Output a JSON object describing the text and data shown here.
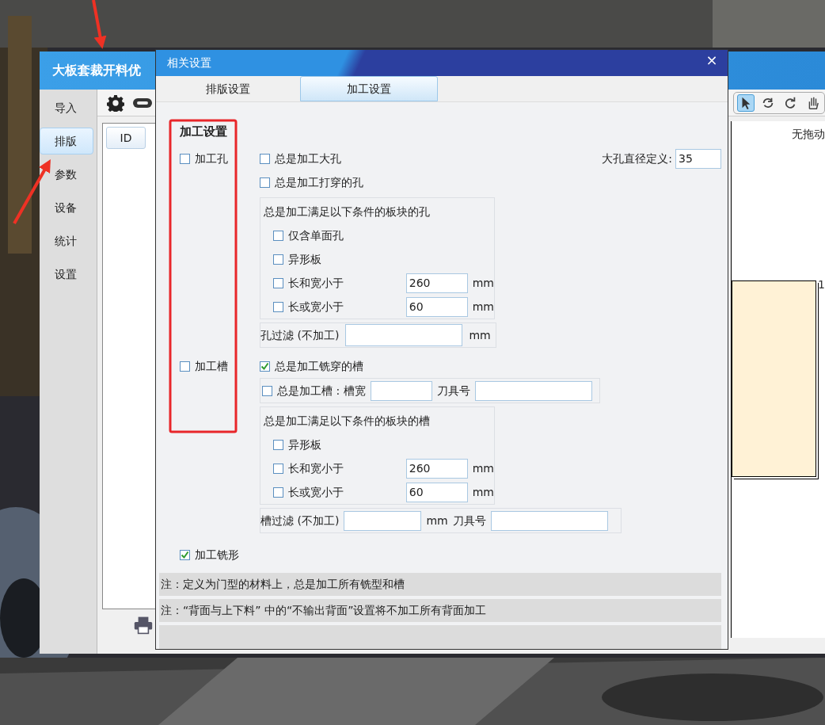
{
  "main_window": {
    "title": "大板套裁开料优",
    "sidebar": [
      {
        "label": "导入",
        "selected": false
      },
      {
        "label": "排版",
        "selected": true
      },
      {
        "label": "参数",
        "selected": false
      },
      {
        "label": "设备",
        "selected": false
      },
      {
        "label": "统计",
        "selected": false
      },
      {
        "label": "设置",
        "selected": false
      }
    ],
    "tools": [
      {
        "kind": "pointer",
        "selected": true
      },
      {
        "kind": "rotate-left",
        "selected": false
      },
      {
        "kind": "rotate-right",
        "selected": false
      },
      {
        "kind": "hand",
        "selected": false
      }
    ],
    "table": {
      "columns": [
        "ID"
      ]
    },
    "canvas": {
      "status": "无拖动",
      "panel_label": "1"
    }
  },
  "dialog": {
    "title": "相关设置",
    "close": "×",
    "tabs": [
      {
        "label": "排版设置",
        "selected": false
      },
      {
        "label": "加工设置",
        "selected": true
      }
    ],
    "heading": "加工设置",
    "hole": {
      "label": "加工孔",
      "checked": false,
      "options": [
        {
          "label": "总是加工大孔",
          "checked": false
        },
        {
          "label": "总是加工打穿的孔",
          "checked": false
        }
      ],
      "diameter": {
        "label": "大孔直径定义:",
        "value": "35"
      },
      "conditions": {
        "title": "总是加工满足以下条件的板块的孔",
        "items": [
          {
            "kind": "check",
            "label": "仅含单面孔",
            "checked": false
          },
          {
            "kind": "check",
            "label": "异形板",
            "checked": false
          },
          {
            "kind": "check_input",
            "label": "长和宽小于",
            "checked": false,
            "value": "260",
            "unit": "mm"
          },
          {
            "kind": "check_input",
            "label": "长或宽小于",
            "checked": false,
            "value": "60",
            "unit": "mm"
          }
        ]
      },
      "filter": {
        "label": "孔过滤 (不加工)",
        "unit": "mm"
      }
    },
    "groove": {
      "label": "加工槽",
      "checked": false,
      "option": {
        "label": "总是加工铣穿的槽",
        "checked": true
      },
      "width_option": {
        "label": "总是加工槽 : 槽宽",
        "checked": false,
        "tool_label": "刀具号"
      },
      "conditions": {
        "title": "总是加工满足以下条件的板块的槽",
        "items": [
          {
            "kind": "check",
            "label": "异形板",
            "checked": false
          },
          {
            "kind": "check_input",
            "label": "长和宽小于",
            "checked": false,
            "value": "260",
            "unit": "mm"
          },
          {
            "kind": "check_input",
            "label": "长或宽小于",
            "checked": false,
            "value": "60",
            "unit": "mm"
          }
        ]
      },
      "filter": {
        "label": "槽过滤 (不加工)",
        "unit": "mm",
        "tool_label": "刀具号"
      }
    },
    "milling": {
      "label": "加工铣形",
      "checked": true
    },
    "notes": [
      "注：定义为门型的材料上，总是加工所有铣型和槽",
      "注：“背面与上下料” 中的“不输出背面”设置将不加工所有背面加工"
    ]
  }
}
